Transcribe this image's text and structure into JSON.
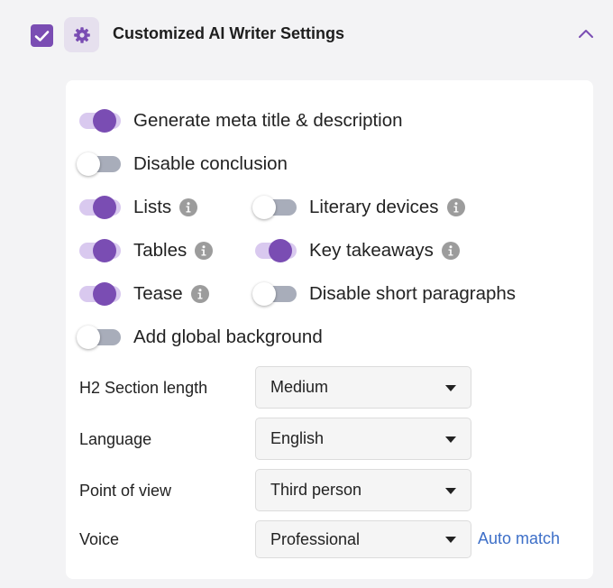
{
  "header": {
    "title": "Customized AI Writer Settings",
    "checked": true
  },
  "toggles": {
    "meta": {
      "label": "Generate meta title & description",
      "on": true
    },
    "conclusion": {
      "label": "Disable conclusion",
      "on": false
    },
    "lists": {
      "label": "Lists",
      "on": true
    },
    "literary": {
      "label": "Literary devices",
      "on": false
    },
    "tables": {
      "label": "Tables",
      "on": true
    },
    "takeaways": {
      "label": "Key takeaways",
      "on": true
    },
    "tease": {
      "label": "Tease",
      "on": true
    },
    "short_paragraphs": {
      "label": "Disable short paragraphs",
      "on": false
    },
    "global_background": {
      "label": "Add global background",
      "on": false
    }
  },
  "fields": {
    "h2_length": {
      "label": "H2 Section length",
      "value": "Medium"
    },
    "language": {
      "label": "Language",
      "value": "English"
    },
    "pov": {
      "label": "Point of view",
      "value": "Third person"
    },
    "voice": {
      "label": "Voice",
      "value": "Professional"
    }
  },
  "auto_match": "Auto match",
  "colors": {
    "accent": "#7a4db3",
    "toggle_on_track": "#d9c9ef",
    "toggle_off_track": "#a8adba",
    "link": "#3d6fc8"
  }
}
